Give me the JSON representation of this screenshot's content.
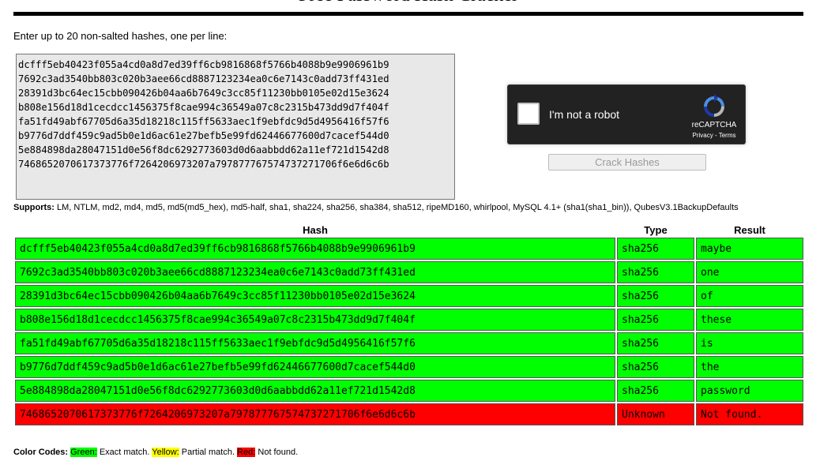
{
  "page": {
    "title": "Free Password Hash Cracker",
    "prompt": "Enter up to 20 non-salted hashes, one per line:",
    "input_value": "dcfff5eb40423f055a4cd0a8d7ed39ff6cb9816868f5766b4088b9e9906961b9\n7692c3ad3540bb803c020b3aee66cd8887123234ea0c6e7143c0add73ff431ed\n28391d3bc64ec15cbb090426b04aa6b7649c3cc85f11230bb0105e02d15e3624\nb808e156d18d1cecdcc1456375f8cae994c36549a07c8c2315b473dd9d7f404f\nfa51fd49abf67705d6a35d18218c115ff5633aec1f9ebfdc9d5d4956416f57f6\nb9776d7ddf459c9ad5b0e1d6ac61e27befb5e99fd62446677600d7cacef544d0\n5e884898da28047151d0e56f8dc6292773603d0d6aabbdd62a11ef721d1542d8\n7468652070617373776f7264206973207a797877767574737271706f6e6d6c6b",
    "supports_label": "Supports:",
    "supports_list": "LM, NTLM, md2, md4, md5, md5(md5_hex), md5-half, sha1, sha224, sha256, sha384, sha512, ripeMD160, whirlpool, MySQL 4.1+ (sha1(sha1_bin)), QubesV3.1BackupDefaults"
  },
  "captcha": {
    "label": "I'm not a robot",
    "brand": "reCAPTCHA",
    "privacy": "Privacy",
    "separator": " - ",
    "terms": "Terms",
    "logo_icon": "recaptcha-logo-icon"
  },
  "crack_button": {
    "label": "Crack Hashes"
  },
  "table": {
    "headers": {
      "hash": "Hash",
      "type": "Type",
      "result": "Result"
    },
    "rows": [
      {
        "hash": "dcfff5eb40423f055a4cd0a8d7ed39ff6cb9816868f5766b4088b9e9906961b9",
        "type": "sha256",
        "result": "maybe",
        "status": "green"
      },
      {
        "hash": "7692c3ad3540bb803c020b3aee66cd8887123234ea0c6e7143c0add73ff431ed",
        "type": "sha256",
        "result": "one",
        "status": "green"
      },
      {
        "hash": "28391d3bc64ec15cbb090426b04aa6b7649c3cc85f11230bb0105e02d15e3624",
        "type": "sha256",
        "result": "of",
        "status": "green"
      },
      {
        "hash": "b808e156d18d1cecdcc1456375f8cae994c36549a07c8c2315b473dd9d7f404f",
        "type": "sha256",
        "result": "these",
        "status": "green"
      },
      {
        "hash": "fa51fd49abf67705d6a35d18218c115ff5633aec1f9ebfdc9d5d4956416f57f6",
        "type": "sha256",
        "result": "is",
        "status": "green"
      },
      {
        "hash": "b9776d7ddf459c9ad5b0e1d6ac61e27befb5e99fd62446677600d7cacef544d0",
        "type": "sha256",
        "result": "the",
        "status": "green"
      },
      {
        "hash": "5e884898da28047151d0e56f8dc6292773603d0d6aabbdd62a11ef721d1542d8",
        "type": "sha256",
        "result": "password",
        "status": "green"
      },
      {
        "hash": "7468652070617373776f7264206973207a797877767574737271706f6e6d6c6b",
        "type": "Unknown",
        "result": "Not found.",
        "status": "red"
      }
    ]
  },
  "legend": {
    "label": "Color Codes:",
    "green": "Green:",
    "green_text": " Exact match. ",
    "yellow": "Yellow:",
    "yellow_text": " Partial match. ",
    "red": "Red:",
    "red_text": " Not found."
  },
  "colors": {
    "exact_match": "#00ff00",
    "partial_match": "#ffff00",
    "not_found": "#ff0000",
    "captcha_bg": "#222222"
  }
}
